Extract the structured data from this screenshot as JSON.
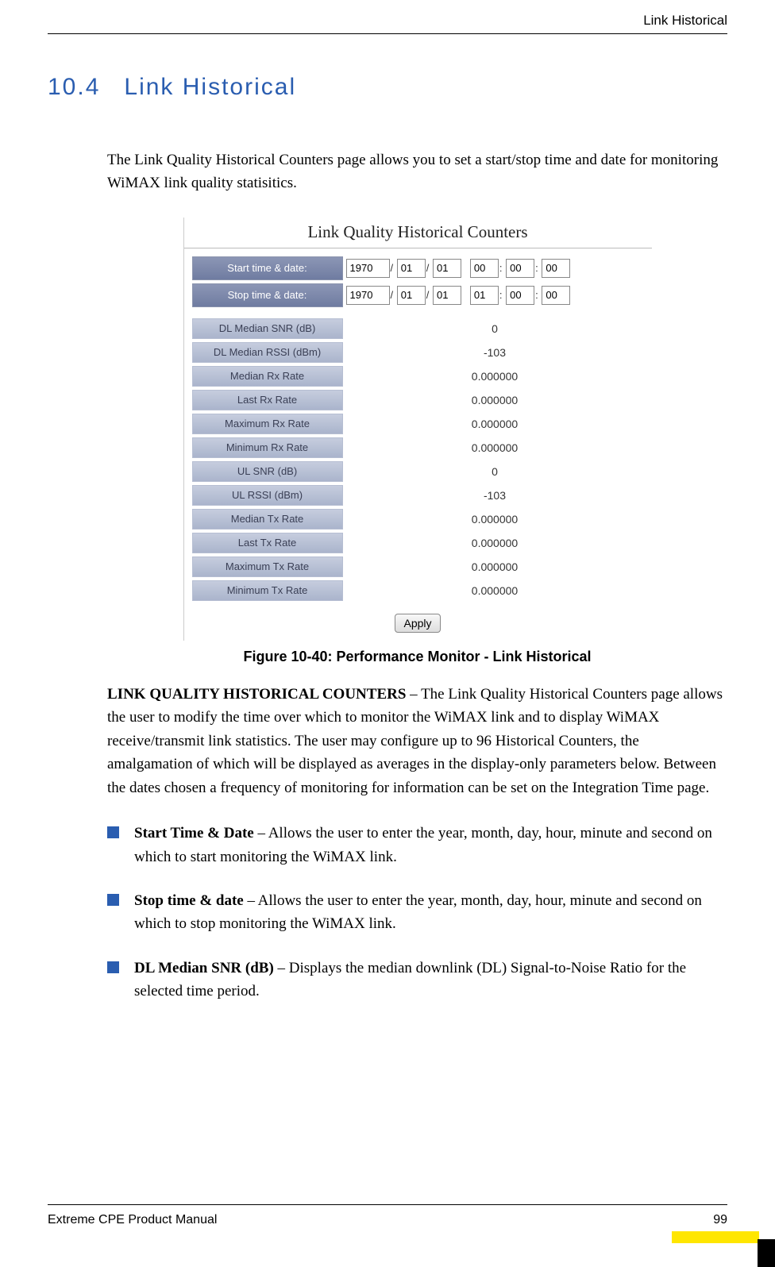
{
  "header": {
    "right": "Link Historical"
  },
  "section": {
    "number": "10.4",
    "title": "Link Historical"
  },
  "intro": "The Link Quality Historical Counters page allows you to set a start/stop time and date for monitoring WiMAX link quality statisitics.",
  "figure": {
    "panel_title": "Link Quality Historical Counters",
    "start_label": "Start time & date:",
    "stop_label": "Stop time & date:",
    "start": {
      "year": "1970",
      "month": "01",
      "day": "01",
      "hour": "00",
      "min": "00",
      "sec": "00"
    },
    "stop": {
      "year": "1970",
      "month": "01",
      "day": "01",
      "hour": "01",
      "min": "00",
      "sec": "00"
    },
    "stats": [
      {
        "label": "DL Median SNR (dB)",
        "value": "0"
      },
      {
        "label": "DL Median RSSI (dBm)",
        "value": "-103"
      },
      {
        "label": "Median Rx Rate",
        "value": "0.000000"
      },
      {
        "label": "Last Rx Rate",
        "value": "0.000000"
      },
      {
        "label": "Maximum Rx Rate",
        "value": "0.000000"
      },
      {
        "label": "Minimum Rx Rate",
        "value": "0.000000"
      },
      {
        "label": "UL SNR (dB)",
        "value": "0"
      },
      {
        "label": "UL RSSI (dBm)",
        "value": "-103"
      },
      {
        "label": "Median Tx Rate",
        "value": "0.000000"
      },
      {
        "label": "Last Tx Rate",
        "value": "0.000000"
      },
      {
        "label": "Maximum Tx Rate",
        "value": "0.000000"
      },
      {
        "label": "Minimum Tx Rate",
        "value": "0.000000"
      }
    ],
    "apply": "Apply",
    "caption": "Figure 10-40: Performance Monitor - Link Historical"
  },
  "desc": {
    "lead": "LINK QUALITY HISTORICAL COUNTERS",
    "body": " – The Link Quality Historical Counters page allows the user to modify the time over which to monitor the WiMAX link and to display WiMAX receive/transmit link statistics. The user may configure up to 96 Historical Counters, the amalgamation of which will be displayed as averages in the display-only parameters below. Between the dates chosen a frequency of monitoring for information can be set on the Integration Time page."
  },
  "bullets": [
    {
      "bold": "Start Time & Date",
      "text": " – Allows the user to enter the year, month, day, hour, minute and second on which to start monitoring the WiMAX link."
    },
    {
      "bold": "Stop time & date",
      "text": " – Allows the user to enter the year, month, day, hour, minute and second on which to stop monitoring the WiMAX link."
    },
    {
      "bold": "DL Median SNR (dB)",
      "text": " – Displays the median downlink (DL) Signal-to-Noise Ratio for the selected time period."
    }
  ],
  "footer": {
    "left": "Extreme CPE Product Manual",
    "right": "99"
  }
}
